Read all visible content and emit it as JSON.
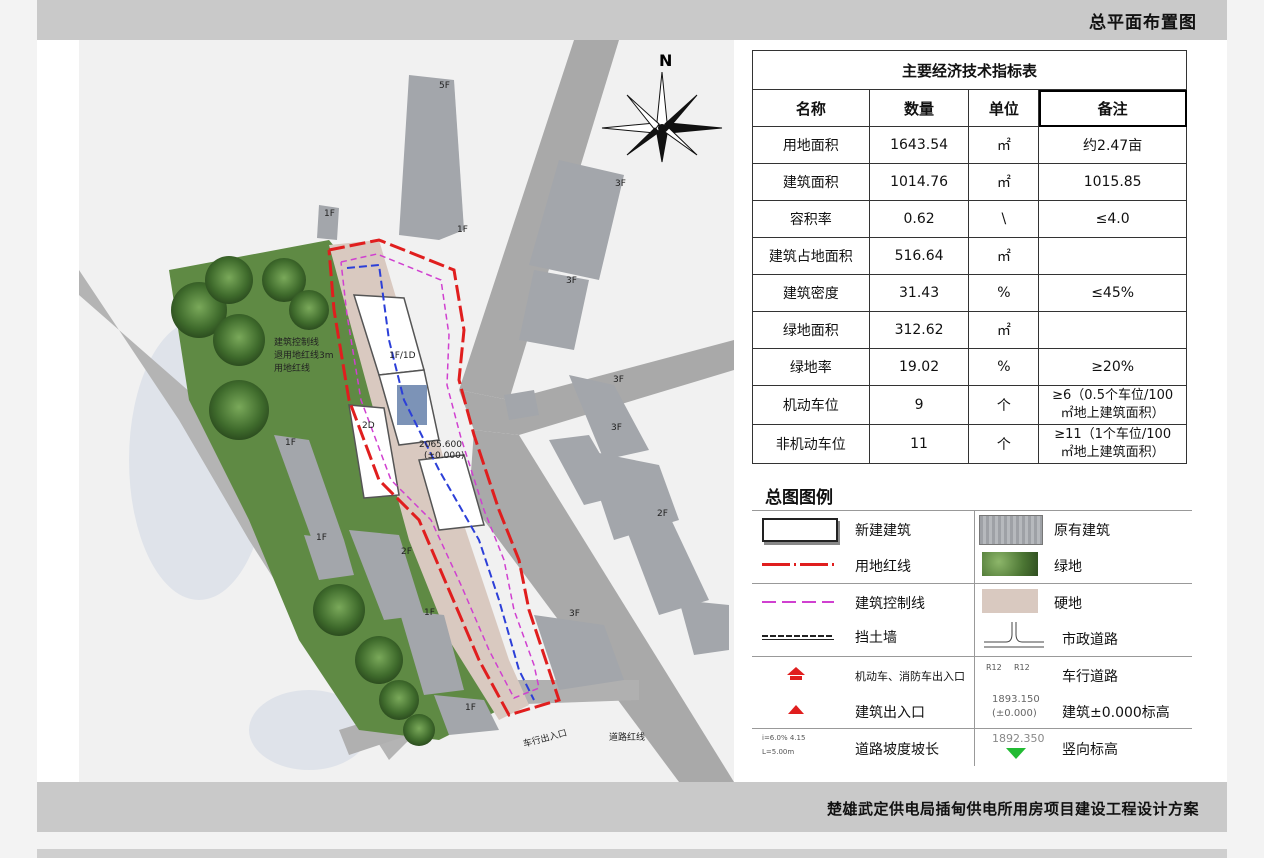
{
  "header": {
    "title": "总平面布置图"
  },
  "footer": {
    "title": "楚雄武定供电局插甸供电所用房项目建设工程设计方案"
  },
  "compass": {
    "label": "N"
  },
  "site_plan": {
    "floor_labels": [
      "5F",
      "1F",
      "1F",
      "3F",
      "3F",
      "1F",
      "3F",
      "3F",
      "2F",
      "1F",
      "1F",
      "2F",
      "1F",
      "3F",
      "1F",
      "1F/1D",
      "2D"
    ],
    "notes": {
      "control_line_a": "建筑控制线",
      "control_line_b": "退用地红线3m",
      "control_line_c": "用地红线",
      "elevation": "2065.600",
      "elevation_zero": "(±0.000)",
      "road_red_line": "道路红线",
      "vehicle_entrance": "车行出入口"
    }
  },
  "indicator_table": {
    "caption": "主要经济技术指标表",
    "headers": [
      "名称",
      "数量",
      "单位",
      "备注"
    ],
    "rows": [
      {
        "name": "用地面积",
        "qty": "1643.54",
        "unit": "㎡",
        "note": "约2.47亩"
      },
      {
        "name": "建筑面积",
        "qty": "1014.76",
        "unit": "㎡",
        "note": "1015.85"
      },
      {
        "name": "容积率",
        "qty": "0.62",
        "unit": "\\",
        "note": "≤4.0"
      },
      {
        "name": "建筑占地面积",
        "qty": "516.64",
        "unit": "㎡",
        "note": ""
      },
      {
        "name": "建筑密度",
        "qty": "31.43",
        "unit": "%",
        "note": "≤45%"
      },
      {
        "name": "绿地面积",
        "qty": "312.62",
        "unit": "㎡",
        "note": ""
      },
      {
        "name": "绿地率",
        "qty": "19.02",
        "unit": "%",
        "note": "≥20%"
      },
      {
        "name": "机动车位",
        "qty": "9",
        "unit": "个",
        "note_a": "≥6（0.5个车位/100",
        "note_b": "㎡地上建筑面积）"
      },
      {
        "name": "非机动车位",
        "qty": "11",
        "unit": "个",
        "note_a": "≥11（1个车位/100",
        "note_b": "㎡地上建筑面积）"
      }
    ]
  },
  "legend": {
    "title": "总图图例",
    "items": {
      "new_building": "新建建筑",
      "existing_building": "原有建筑",
      "red_line": "用地红线",
      "green": "绿地",
      "control_line": "建筑控制线",
      "hard_ground": "硬地",
      "retaining_wall": "挡土墙",
      "municipal_road": "市政道路",
      "vehicle_fire_entrance": "机动车、消防车出入口",
      "driveway": "车行道路",
      "building_entrance": "建筑出入口",
      "elevation_mark": "建筑±0.000标高",
      "slope": "道路坡度坡长",
      "vertical_elevation": "竖向标高"
    },
    "symbol_text": {
      "r12_a": "R12",
      "r12_b": "R12",
      "elev_value": "1893.150",
      "elev_zero": "(±0.000)",
      "slope_top": "i=6.0% 4.15",
      "slope_bottom": "L=5.00m",
      "vert_value": "1892.350"
    }
  },
  "colors": {
    "red_line": "#e01e1e",
    "control_line": "#d040d0",
    "bar": "#c9c9c9",
    "green": "#4f7a3a",
    "road": "#a9a9a9"
  }
}
